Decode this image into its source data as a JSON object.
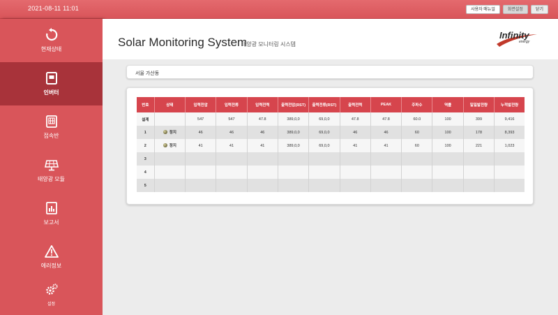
{
  "topbar": {
    "datetime": "2021-08-11 11:01",
    "buttons": [
      "사용자 매뉴얼",
      "화면설정",
      "닫기"
    ]
  },
  "sidebar": {
    "items": [
      {
        "label": "현재상태",
        "icon": "refresh-icon",
        "active": false
      },
      {
        "label": "인버터",
        "icon": "inverter-icon",
        "active": true
      },
      {
        "label": "접속반",
        "icon": "junction-box-icon",
        "active": false
      },
      {
        "label": "태양광 모듈",
        "icon": "solar-panel-icon",
        "active": false
      },
      {
        "label": "보고서",
        "icon": "report-icon",
        "active": false
      },
      {
        "label": "에러정보",
        "icon": "warning-icon",
        "active": false
      },
      {
        "label": "설정",
        "icon": "gear-icon",
        "active": false
      }
    ]
  },
  "header": {
    "title": "Solar Monitoring System",
    "subtitle": "태양광 모니터링 시스템",
    "logo_text": "Infinity",
    "logo_sub": "energy"
  },
  "location": "서울 가산동",
  "table": {
    "columns": [
      "번호",
      "상태",
      "입력전압",
      "입력전류",
      "입력전력",
      "출력전압(RST)",
      "출력전류(RST)",
      "출력전력",
      "PEAK",
      "주파수",
      "역률",
      "일일발전량",
      "누적발전량"
    ],
    "rows": [
      [
        "설계",
        "",
        "547",
        "547",
        "47.8",
        "389,0,0",
        "69,0,0",
        "47.8",
        "47.8",
        "60.0",
        "100",
        "399",
        "9,416"
      ],
      [
        "1",
        "정지",
        "46",
        "46",
        "46",
        "389,0,0",
        "69,0,0",
        "46",
        "46",
        "60",
        "100",
        "178",
        "8,393"
      ],
      [
        "2",
        "정지",
        "41",
        "41",
        "41",
        "389,0,0",
        "69,0,0",
        "41",
        "41",
        "60",
        "100",
        "221",
        "1,023"
      ],
      [
        "3",
        "",
        "",
        "",
        "",
        "",
        "",
        "",
        "",
        "",
        "",
        "",
        ""
      ],
      [
        "4",
        "",
        "",
        "",
        "",
        "",
        "",
        "",
        "",
        "",
        "",
        "",
        ""
      ],
      [
        "5",
        "",
        "",
        "",
        "",
        "",
        "",
        "",
        "",
        "",
        "",
        "",
        ""
      ]
    ]
  },
  "colors": {
    "brand_red": "#d9555a",
    "active_red": "#a8333a",
    "header_red": "#d6454d"
  }
}
